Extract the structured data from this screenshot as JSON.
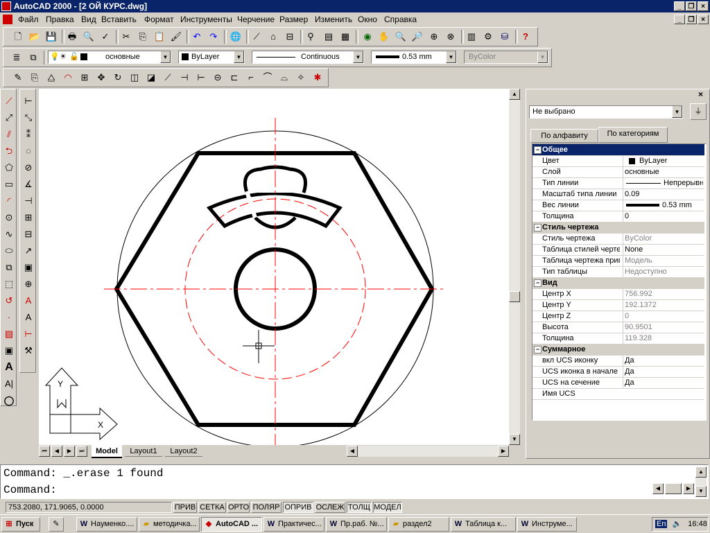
{
  "window": {
    "title": "AutoCAD 2000 - [2 ОЙ КУРС.dwg]"
  },
  "menu": [
    "Файл",
    "Правка",
    "Вид",
    "Вставить",
    "Формат",
    "Инструменты",
    "Черчение",
    "Размер",
    "Изменить",
    "Окно",
    "Справка"
  ],
  "layer_toolbar": {
    "layer": "основные",
    "color": "ByLayer",
    "linetype": "Continuous",
    "lineweight": "0.53 mm",
    "plotstyle": "ByColor"
  },
  "tabs": {
    "model": "Model",
    "layout1": "Layout1",
    "layout2": "Layout2"
  },
  "properties": {
    "selector": "Не выбрано",
    "tab_alpha": "По алфавиту",
    "tab_category": "По категориям",
    "rows": [
      {
        "k": "Общее",
        "v": "",
        "cat": true
      },
      {
        "k": "Цвет",
        "v": "ByLayer"
      },
      {
        "k": "Слой",
        "v": "основные"
      },
      {
        "k": "Тип линии",
        "v": "Непрерывн"
      },
      {
        "k": "Масштаб типа линии",
        "v": "0.09"
      },
      {
        "k": "Вес линии",
        "v": "0.53 mm"
      },
      {
        "k": "Толщина",
        "v": "0"
      },
      {
        "k": "Стиль чертежа",
        "v": "",
        "cat": true
      },
      {
        "k": "Стиль чертежа",
        "v": "ByColor",
        "grey": true
      },
      {
        "k": "Таблица стилей черте",
        "v": "None"
      },
      {
        "k": "Таблица чертежа прив",
        "v": "Модель",
        "grey": true
      },
      {
        "k": "Тип таблицы",
        "v": "Недоступно",
        "grey": true
      },
      {
        "k": "Вид",
        "v": "",
        "cat": true
      },
      {
        "k": "Центр X",
        "v": "756.992",
        "grey": true
      },
      {
        "k": "Центр Y",
        "v": "192.1372",
        "grey": true
      },
      {
        "k": "Центр Z",
        "v": "0",
        "grey": true
      },
      {
        "k": "Высота",
        "v": "90.9501",
        "grey": true
      },
      {
        "k": "Толщина",
        "v": "119.328",
        "grey": true
      },
      {
        "k": "Суммарное",
        "v": "",
        "cat": true
      },
      {
        "k": "вкл UCS иконку",
        "v": "Да"
      },
      {
        "k": "UCS иконка в начале к",
        "v": "Да"
      },
      {
        "k": "UCS на сечение",
        "v": "Да"
      },
      {
        "k": "Имя UCS",
        "v": ""
      }
    ]
  },
  "command": {
    "line1": "Command:  _.erase 1 found",
    "line2": "Command:"
  },
  "status": {
    "coords": "753.2080, 171.9065, 0.0000",
    "buttons": [
      "ПРИВ",
      "СЕТКА",
      "ОРТО",
      "ПОЛЯР",
      "ОПРИВ",
      "ОСЛЕЖ",
      "ТОЛЩ",
      "МОДЕЛ"
    ]
  },
  "taskbar": {
    "start": "Пуск",
    "tasks": [
      "Науменко....",
      "методичка...",
      "AutoCAD ...",
      "Практичес...",
      "Пр.раб. №...",
      "раздел2",
      "Таблица к...",
      "Инструме..."
    ],
    "lang": "En",
    "clock": "16:48"
  },
  "colors": {
    "titlebar": "#0a246a",
    "centerline": "#ff0000",
    "selection": "#0a246a"
  }
}
